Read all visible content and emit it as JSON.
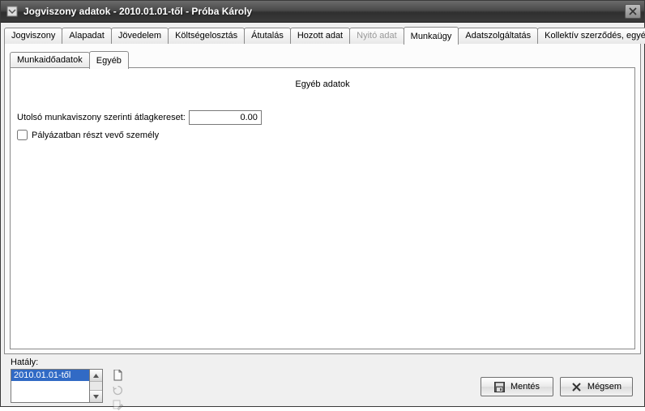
{
  "window": {
    "title": "Jogviszony adatok - 2010.01.01-től - Próba Károly"
  },
  "tabs": {
    "main": [
      {
        "label": "Jogviszony",
        "active": false,
        "disabled": false
      },
      {
        "label": "Alapadat",
        "active": false,
        "disabled": false
      },
      {
        "label": "Jövedelem",
        "active": false,
        "disabled": false
      },
      {
        "label": "Költségelosztás",
        "active": false,
        "disabled": false
      },
      {
        "label": "Átutalás",
        "active": false,
        "disabled": false
      },
      {
        "label": "Hozott adat",
        "active": false,
        "disabled": false
      },
      {
        "label": "Nyitó adat",
        "active": false,
        "disabled": true
      },
      {
        "label": "Munkaügy",
        "active": true,
        "disabled": false
      },
      {
        "label": "Adatszolgáltatás",
        "active": false,
        "disabled": false
      },
      {
        "label": "Kollektív szerződés, egyéb",
        "active": false,
        "disabled": false
      }
    ],
    "inner": [
      {
        "label": "Munkaidőadatok",
        "active": false
      },
      {
        "label": "Egyéb",
        "active": true
      }
    ]
  },
  "panel": {
    "section_title": "Egyéb adatok",
    "avg_label": "Utolsó munkaviszony szerinti átlagkereset:",
    "avg_value": "0.00",
    "tender_checked": false,
    "tender_label": "Pályázatban részt vevő személy"
  },
  "footer": {
    "hataly_label": "Hatály:",
    "hataly_items": [
      {
        "label": "2010.01.01-től",
        "selected": true
      }
    ],
    "save_label": "Mentés",
    "cancel_label": "Mégsem"
  }
}
